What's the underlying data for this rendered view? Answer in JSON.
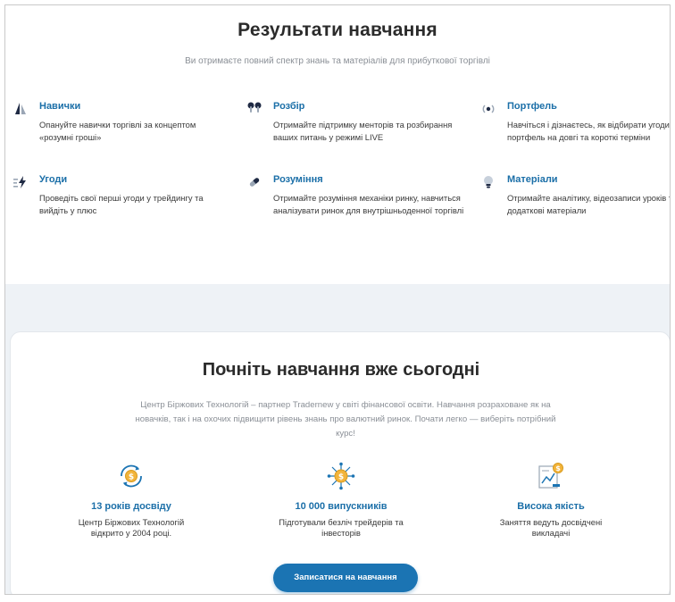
{
  "results": {
    "title": "Результати навчання",
    "subtitle": "Ви отримаєте повний спектр знань та матеріалів для прибуткової торгівлі",
    "features": [
      {
        "icon": "sails-icon",
        "title": "Навички",
        "description": "Опануйте навички торгівлі за концептом «розумні гроші»"
      },
      {
        "icon": "earbuds-icon",
        "title": "Розбір",
        "description": "Отримайте підтримку менторів та розбирання ваших питань у режимі LIVE"
      },
      {
        "icon": "broadcast-icon",
        "title": "Портфель",
        "description": "Навчіться і дізнаєтесь, як відбирати угоди в свій портфель на довгі та короткі терміни"
      },
      {
        "icon": "lightning-icon",
        "title": "Угоди",
        "description": "Проведіть свої перші угоди у трейдингу та вийдіть у плюс"
      },
      {
        "icon": "pill-icon",
        "title": "Розуміння",
        "description": "Отримайте розуміння механіки ринку, навчиться аналізувати ринок для внутрішньоденної торгівлі"
      },
      {
        "icon": "lightbulb-icon",
        "title": "Матеріали",
        "description": "Отримайте аналітику, відеозаписи уроків та всі додаткові матеріали"
      }
    ]
  },
  "start": {
    "title": "Почніть навчання вже сьогодні",
    "description": "Центр Біржових Технологій – партнер Tradernew у світі фінансової освіти. Навчання розраховане як на новачків, так і на охочих підвищити рівень знань про валютний ринок. Почати легко — виберіть потрібний курс!",
    "stats": [
      {
        "icon": "coin-cycle-icon",
        "title": "13 років досвіду",
        "description": "Центр Біржових Технологій відкрито у 2004 році."
      },
      {
        "icon": "coin-network-icon",
        "title": "10 000 випускників",
        "description": "Підготували безліч трейдерів та інвесторів"
      },
      {
        "icon": "chart-coin-icon",
        "title": "Висока якість",
        "description": "Заняття ведуть досвідчені викладачі"
      }
    ],
    "button_label": "Записатися на навчання"
  },
  "colors": {
    "accent": "#1b6fa8",
    "button": "#1b74b3",
    "section_bg": "#eef2f6"
  }
}
